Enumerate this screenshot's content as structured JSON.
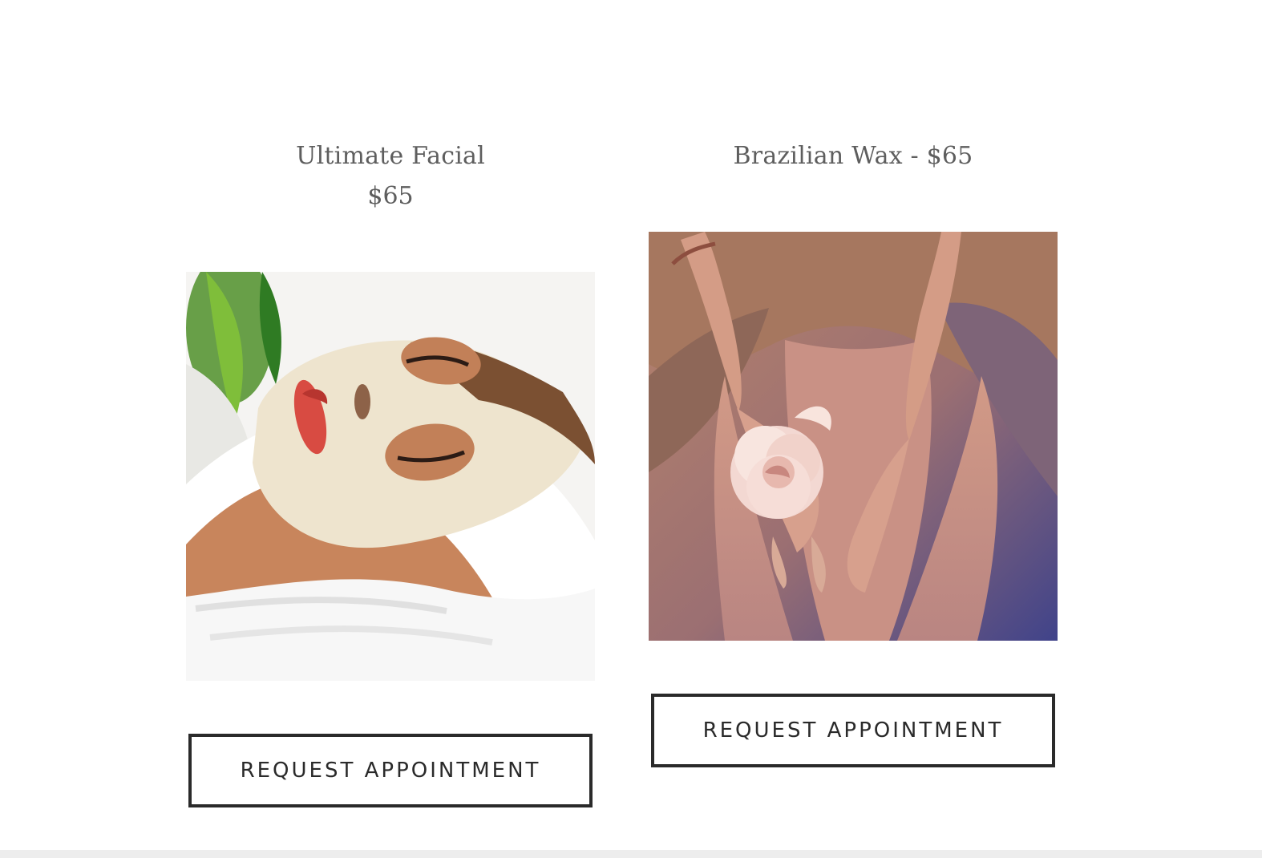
{
  "services": [
    {
      "title": "Ultimate Facial",
      "price": "$65",
      "image_subject": "woman-with-facial-mask-photo",
      "button_label": "REQUEST APPOINTMENT"
    },
    {
      "title": "Brazilian Wax - $65",
      "price": "",
      "image_subject": "hands-holding-rose-photo",
      "button_label": "REQUEST APPOINTMENT"
    }
  ],
  "colors": {
    "text": "#5e5e5e",
    "button_border": "#2a2a2a",
    "background": "#ffffff",
    "footer_strip": "#ededed"
  }
}
